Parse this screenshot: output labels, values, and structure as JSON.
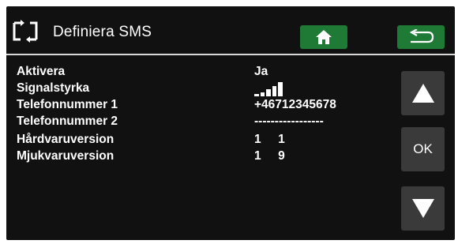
{
  "header": {
    "title": "Definiera  SMS",
    "logo_icon": "refresh-arrows-icon",
    "home_icon": "home-icon",
    "back_icon": "return-arrow-icon"
  },
  "rows": [
    {
      "label": "Aktivera",
      "value": "Ja"
    },
    {
      "label": "Signalstyrka",
      "value_signal_level": 5
    },
    {
      "label": "Telefonnummer 1",
      "value": "+46712345678"
    },
    {
      "label": "Telefonnummer 2",
      "value": "-----------------"
    },
    {
      "label": "Hårdvaruversion",
      "value": "1     1"
    },
    {
      "label": "Mjukvaruversion",
      "value": "1     9"
    }
  ],
  "side": {
    "up_icon": "triangle-up-icon",
    "ok_label": "OK",
    "down_icon": "triangle-down-icon"
  },
  "colors": {
    "background": "#111111",
    "button_green": "#1f7a36",
    "side_button": "#3a3a3a",
    "text": "#ffffff"
  }
}
